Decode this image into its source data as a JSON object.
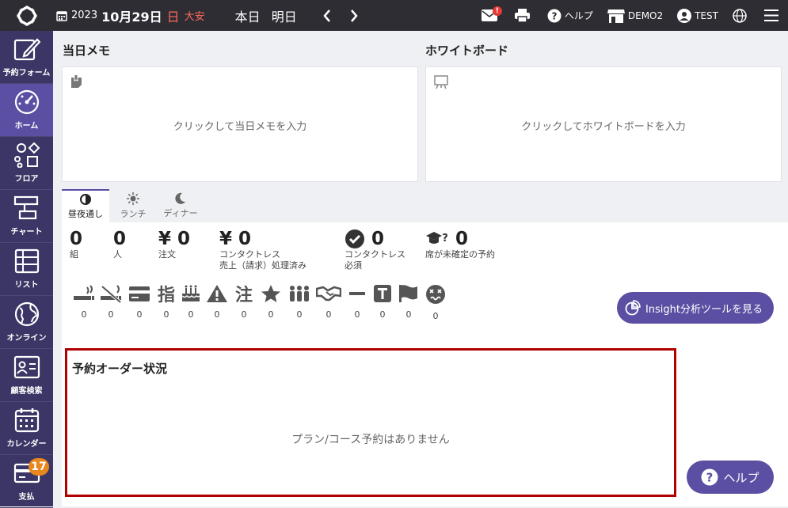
{
  "topbar": {
    "year": "2023",
    "monthday": "10月29日",
    "weekday": "日",
    "rokuyo": "大安",
    "today": "本日",
    "tomorrow": "明日",
    "mail_badge": "!",
    "help": "ヘルプ",
    "store": "DEMO2",
    "user": "TEST"
  },
  "sidebar": {
    "items": [
      {
        "label": "予約フォーム",
        "icon": "edit-icon"
      },
      {
        "label": "ホーム",
        "icon": "dashboard-icon"
      },
      {
        "label": "フロア",
        "icon": "floor-icon"
      },
      {
        "label": "チャート",
        "icon": "chart-icon"
      },
      {
        "label": "リスト",
        "icon": "list-icon"
      },
      {
        "label": "オンライン",
        "icon": "globe-icon"
      },
      {
        "label": "顧客検索",
        "icon": "customer-card-icon"
      },
      {
        "label": "カレンダー",
        "icon": "calendar-icon"
      },
      {
        "label": "支払",
        "icon": "payment-card-icon",
        "badge": "17"
      }
    ]
  },
  "memo": {
    "title": "当日メモ",
    "placeholder": "クリックして当日メモを入力"
  },
  "whiteboard": {
    "title": "ホワイトボード",
    "placeholder": "クリックしてホワイトボードを入力"
  },
  "tabs": [
    "昼夜通し",
    "ランチ",
    "ディナー"
  ],
  "stats": {
    "groups": {
      "value": "0",
      "label": "組"
    },
    "people": {
      "value": "0",
      "label": "人"
    },
    "orders": {
      "value": "¥ 0",
      "label": "注文"
    },
    "contactless_sales": {
      "value": "¥ 0",
      "label1": "コンタクトレス",
      "label2": "売上（請求）処理済み"
    },
    "contactless_required": {
      "value": "0",
      "label1": "コンタクトレス",
      "label2": "必須"
    },
    "unassigned": {
      "value": "0",
      "label": "席が未確定の予約"
    }
  },
  "icon_counts": [
    "0",
    "0",
    "0",
    "0",
    "0",
    "0",
    "0",
    "0",
    "0",
    "0",
    "0",
    "0",
    "0",
    "0"
  ],
  "insight_button": "Insight分析ツールを見る",
  "order_status": {
    "title": "予約オーダー状況",
    "empty": "プラン/コース予約はありません"
  },
  "help_button": "ヘルプ",
  "colors": {
    "accent": "#5a4fa2",
    "sidebar": "#3b3665",
    "topbar": "#2d2d33",
    "highlight": "#b00000",
    "holiday": "#ff6b5b",
    "badge": "#e8871e"
  }
}
